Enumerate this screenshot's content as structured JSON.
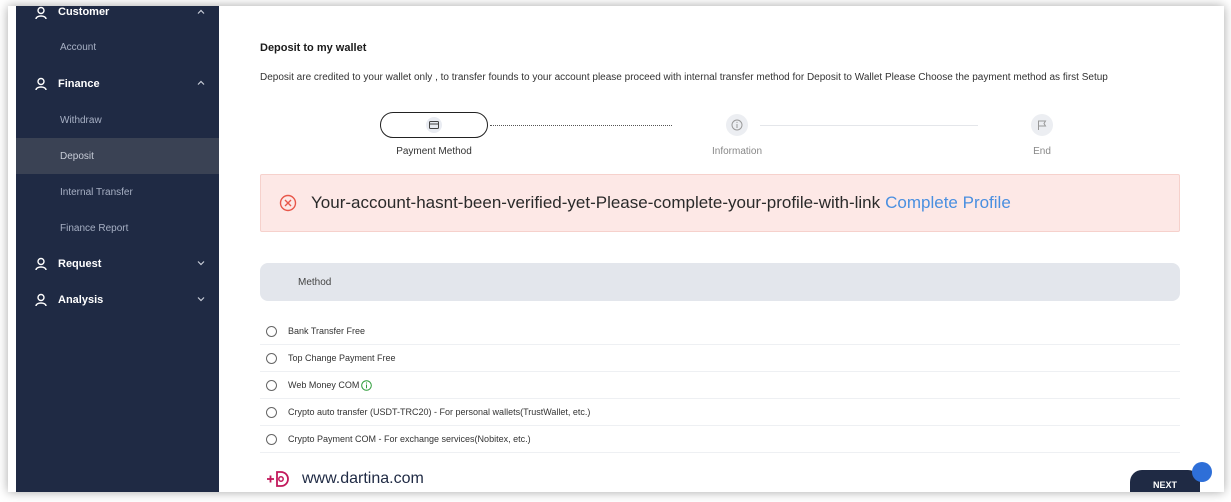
{
  "sidebar": {
    "groups": [
      {
        "label": "Customer",
        "subs": [
          "Account"
        ]
      },
      {
        "label": "Finance",
        "subs": [
          "Withdraw",
          "Deposit",
          "Internal Transfer",
          "Finance Report"
        ]
      },
      {
        "label": "Request"
      },
      {
        "label": "Analysis"
      }
    ],
    "active_item": "Deposit"
  },
  "page": {
    "title": "Deposit to my wallet",
    "description": "Deposit are credited to your wallet only , to transfer founds to your account please proceed with internal transfer method for Deposit to Wallet Please Choose the payment method as first Setup"
  },
  "stepper": {
    "steps": [
      "Payment Method",
      "Information",
      "End"
    ],
    "current_step": 1
  },
  "alert": {
    "message": "Your-account-hasnt-been-verified-yet-Please-complete-your-profile-with-link",
    "link_text": "Complete Profile"
  },
  "method": {
    "header": "Method",
    "options": [
      "Bank Transfer Free",
      "Top Change Payment Free",
      "Web Money COM",
      "Crypto auto transfer (USDT-TRC20) - For personal wallets(TrustWallet, etc.)",
      "Crypto Payment COM - For exchange services(Nobitex, etc.)"
    ]
  },
  "footer": {
    "brand": "www.dartina.com",
    "next_label": "NEXT"
  },
  "colors": {
    "sidebar_bg": "#1f2a44",
    "active_bg": "#3a4254",
    "alert_bg": "#fde8e6",
    "link": "#4a8fe0",
    "logo_accent": "#c2185b"
  }
}
